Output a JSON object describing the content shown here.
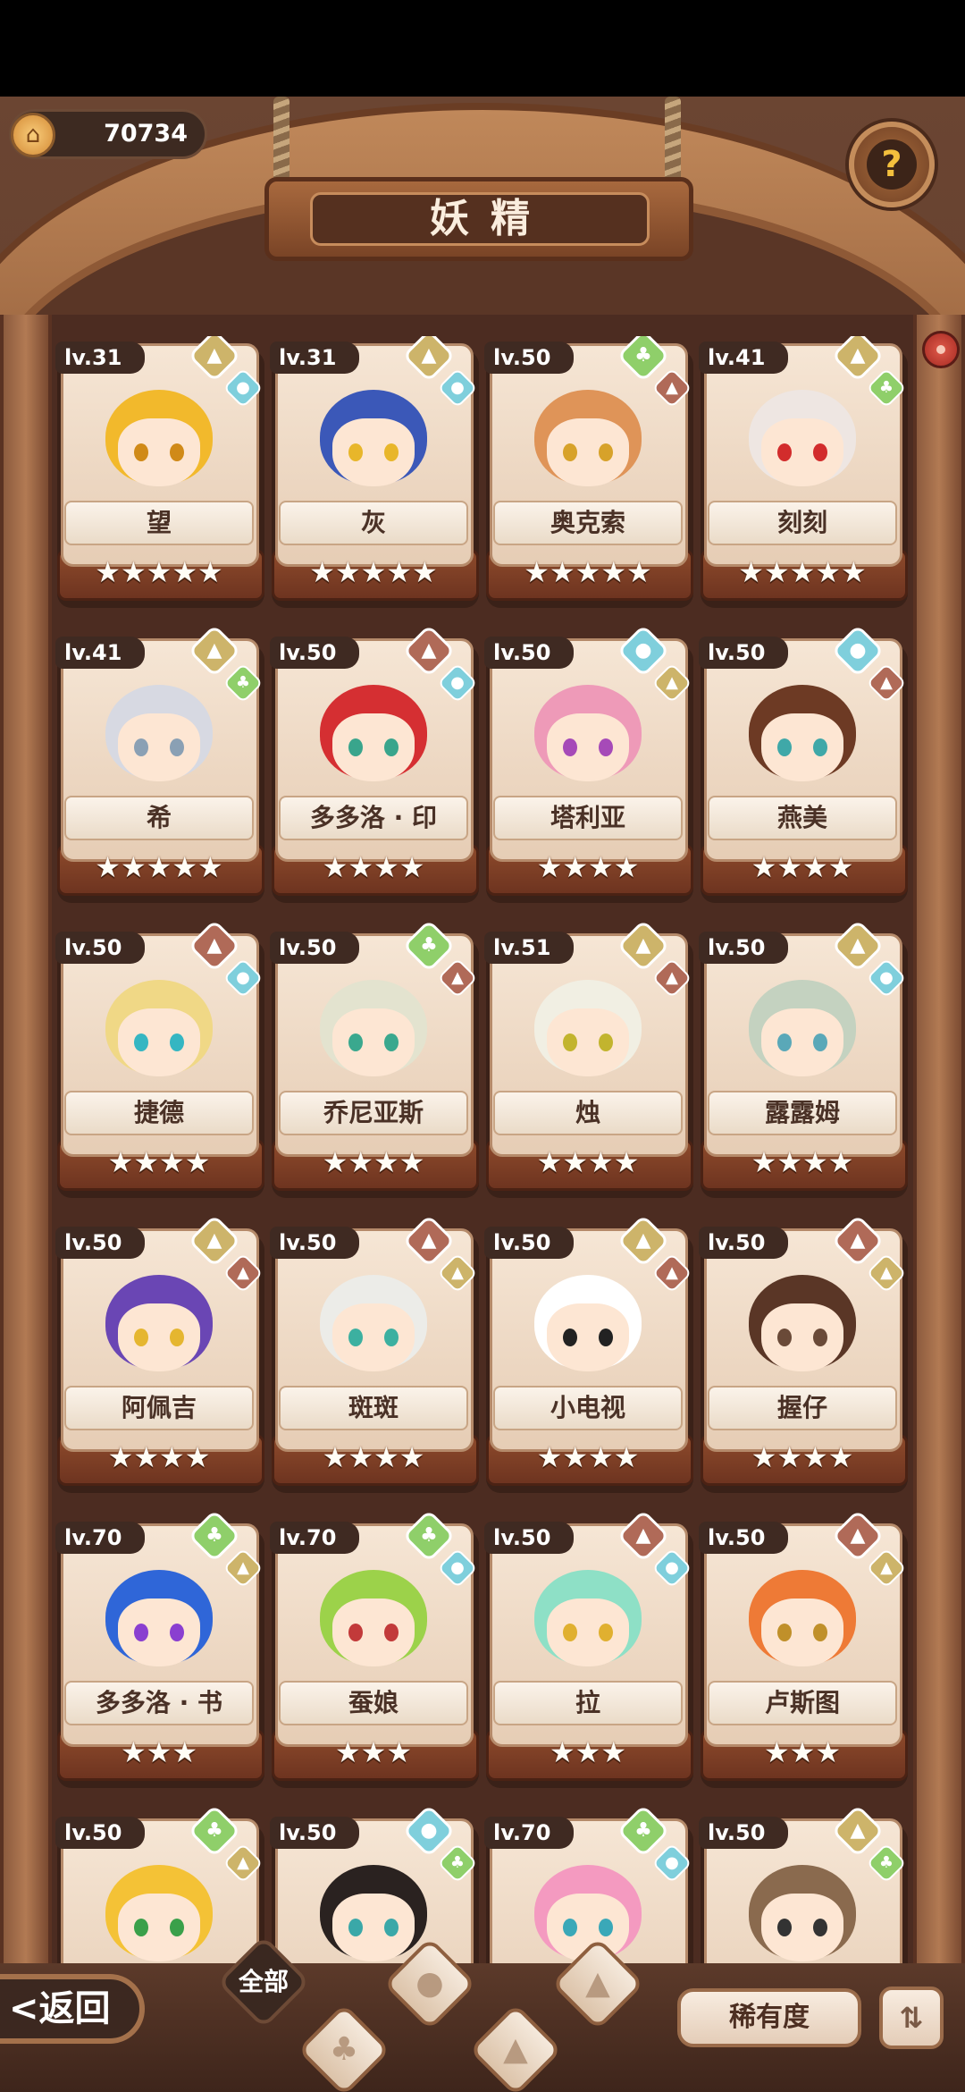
{
  "header": {
    "coins": "70734",
    "coin_icon": "house-coin-icon",
    "title": "妖精",
    "help_icon": "sprout-question-icon"
  },
  "colors": {
    "badge_water": "#7fcfdc",
    "badge_plant": "#8fcf6a",
    "badge_earth": "#cdb46a",
    "badge_fire": "#b06a58"
  },
  "fairies": [
    {
      "level": "lv.31",
      "name": "望",
      "stars": "★★★★★",
      "badges": [
        "earth",
        "water"
      ],
      "hair": "#f2b92c",
      "eye": "#d08a18"
    },
    {
      "level": "lv.31",
      "name": "灰",
      "stars": "★★★★★",
      "badges": [
        "earth",
        "water"
      ],
      "hair": "#3b58b8",
      "eye": "#e8b62a"
    },
    {
      "level": "lv.50",
      "name": "奥克索",
      "stars": "★★★★★",
      "badges": [
        "plant",
        "fire"
      ],
      "hair": "#df9458",
      "eye": "#d7a22a"
    },
    {
      "level": "lv.41",
      "name": "刻刻",
      "stars": "★★★★★",
      "badges": [
        "earth",
        "plant"
      ],
      "hair": "#eee6e2",
      "eye": "#d22c2c"
    },
    {
      "level": "lv.41",
      "name": "希",
      "stars": "★★★★★",
      "badges": [
        "earth",
        "plant"
      ],
      "hair": "#d7d9e2",
      "eye": "#8aa0b4"
    },
    {
      "level": "lv.50",
      "name": "多多洛 · 印",
      "stars": "★★★★",
      "badges": [
        "fire",
        "water"
      ],
      "hair": "#d52f32",
      "eye": "#39a58c"
    },
    {
      "level": "lv.50",
      "name": "塔利亚",
      "stars": "★★★★",
      "badges": [
        "water",
        "earth"
      ],
      "hair": "#ee9ab8",
      "eye": "#a64ab8"
    },
    {
      "level": "lv.50",
      "name": "燕美",
      "stars": "★★★★",
      "badges": [
        "water",
        "fire"
      ],
      "hair": "#6d3a24",
      "eye": "#3fa8a8"
    },
    {
      "level": "lv.50",
      "name": "捷德",
      "stars": "★★★★",
      "badges": [
        "fire",
        "water"
      ],
      "hair": "#f0d886",
      "eye": "#35b6c2"
    },
    {
      "level": "lv.50",
      "name": "乔尼亚斯",
      "stars": "★★★★",
      "badges": [
        "plant",
        "fire"
      ],
      "hair": "#e3e3cf",
      "eye": "#3aa88e"
    },
    {
      "level": "lv.51",
      "name": "烛",
      "stars": "★★★★",
      "badges": [
        "earth",
        "fire"
      ],
      "hair": "#f1efe3",
      "eye": "#c2b42e"
    },
    {
      "level": "lv.50",
      "name": "露露姆",
      "stars": "★★★★",
      "badges": [
        "earth",
        "water"
      ],
      "hair": "#c4d2c0",
      "eye": "#5aa8b8"
    },
    {
      "level": "lv.50",
      "name": "阿佩吉",
      "stars": "★★★★",
      "badges": [
        "earth",
        "fire"
      ],
      "hair": "#6a46b4",
      "eye": "#e5b630"
    },
    {
      "level": "lv.50",
      "name": "斑斑",
      "stars": "★★★★",
      "badges": [
        "fire",
        "earth"
      ],
      "hair": "#ecece8",
      "eye": "#3cb0a0"
    },
    {
      "level": "lv.50",
      "name": "小电视",
      "stars": "★★★★",
      "badges": [
        "earth",
        "fire"
      ],
      "hair": "#ffffff",
      "eye": "#222222"
    },
    {
      "level": "lv.50",
      "name": "握仔",
      "stars": "★★★★",
      "badges": [
        "fire",
        "earth"
      ],
      "hair": "#5a3626",
      "eye": "#6a4a38"
    },
    {
      "level": "lv.70",
      "name": "多多洛 · 书",
      "stars": "★★★",
      "badges": [
        "plant",
        "earth"
      ],
      "hair": "#2f66d8",
      "eye": "#8a3fd0"
    },
    {
      "level": "lv.70",
      "name": "蚕娘",
      "stars": "★★★",
      "badges": [
        "plant",
        "water"
      ],
      "hair": "#9cd24a",
      "eye": "#c23a3a"
    },
    {
      "level": "lv.50",
      "name": "拉",
      "stars": "★★★",
      "badges": [
        "fire",
        "water"
      ],
      "hair": "#8ee0c6",
      "eye": "#e0b030"
    },
    {
      "level": "lv.50",
      "name": "卢斯图",
      "stars": "★★★",
      "badges": [
        "fire",
        "earth"
      ],
      "hair": "#ee7a36",
      "eye": "#c0902a"
    },
    {
      "level": "lv.50",
      "name": "",
      "stars": "",
      "badges": [
        "plant",
        "earth"
      ],
      "hair": "#f4c236",
      "eye": "#3aa04a"
    },
    {
      "level": "lv.50",
      "name": "",
      "stars": "",
      "badges": [
        "water",
        "plant"
      ],
      "hair": "#2a2220",
      "eye": "#3aa8a8"
    },
    {
      "level": "lv.70",
      "name": "",
      "stars": "",
      "badges": [
        "plant",
        "water"
      ],
      "hair": "#f49ac0",
      "eye": "#3aa8b8"
    },
    {
      "level": "lv.50",
      "name": "",
      "stars": "",
      "badges": [
        "earth",
        "plant"
      ],
      "hair": "#8a6a4e",
      "eye": "#333333"
    }
  ],
  "footer": {
    "back_label": "返回",
    "filter_all": "全部",
    "filter_icons": [
      "plant-icon",
      "water-icon",
      "fire-icon",
      "earth-icon"
    ],
    "rarity_label": "稀有度",
    "sort_icon": "sort-icon"
  }
}
